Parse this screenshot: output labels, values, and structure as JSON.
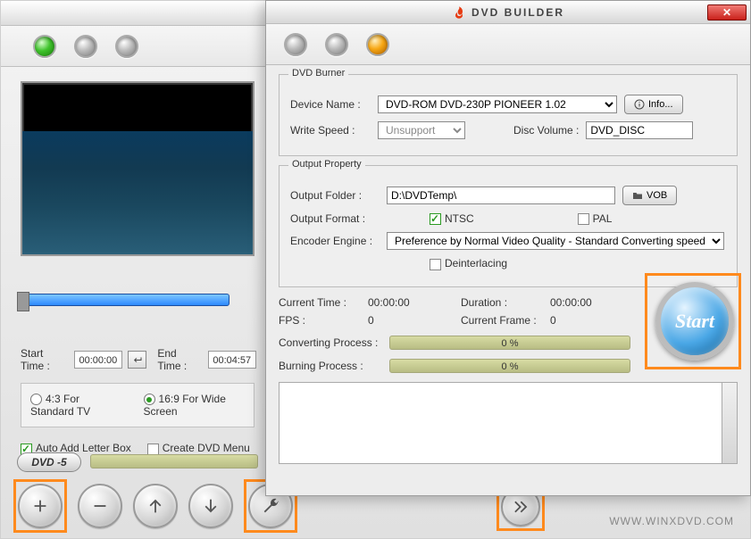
{
  "app": {
    "title": "DVD BUILDER",
    "close_glyph": "✕",
    "footer_url": "WWW.WINXDVD.COM"
  },
  "burner": {
    "legend": "DVD Burner",
    "device_label": "Device Name :",
    "device_value": "DVD-ROM DVD-230P PIONEER  1.02",
    "info_label": "Info...",
    "write_speed_label": "Write Speed :",
    "write_speed_value": "Unsupport",
    "disc_volume_label": "Disc Volume :",
    "disc_volume_value": "DVD_DISC"
  },
  "output": {
    "legend": "Output Property",
    "folder_label": "Output Folder :",
    "folder_value": "D:\\DVDTemp\\",
    "vob_label": "VOB",
    "format_label": "Output Format :",
    "ntsc_label": "NTSC",
    "ntsc_checked": true,
    "pal_label": "PAL",
    "pal_checked": false,
    "encoder_label": "Encoder Engine :",
    "encoder_value": "Preference by Normal Video Quality - Standard Converting speed",
    "deinterlacing_label": "Deinterlacing",
    "deinterlacing_checked": false
  },
  "stats": {
    "current_time_label": "Current Time :",
    "current_time_value": "00:00:00",
    "duration_label": "Duration :",
    "duration_value": "00:00:00",
    "fps_label": "FPS :",
    "fps_value": "0",
    "current_frame_label": "Current Frame :",
    "current_frame_value": "0"
  },
  "progress": {
    "converting_label": "Converting Process :",
    "converting_value": "0 %",
    "burning_label": "Burning Process :",
    "burning_value": "0 %"
  },
  "start_label": "Start",
  "preview": {
    "start_time_label": "Start Time :",
    "start_time_value": "00:00:00",
    "end_time_label": "End Time :",
    "end_time_value": "00:04:57"
  },
  "aspect": {
    "ratio_43": "4:3 For Standard TV",
    "ratio_43_checked": false,
    "ratio_169": "16:9 For Wide Screen",
    "ratio_169_checked": true
  },
  "options": {
    "letterbox_label": "Auto Add Letter Box",
    "letterbox_checked": true,
    "menu_label": "Create DVD Menu",
    "menu_checked": false
  },
  "dvd_badge": "DVD -5",
  "setting_button_label": "Setting Button"
}
